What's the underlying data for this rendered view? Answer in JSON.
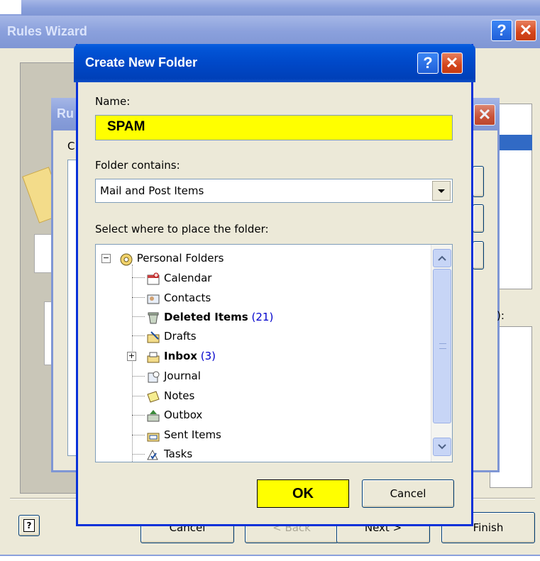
{
  "colors": {
    "title_active": "#0048c8",
    "title_inactive": "#8aa0dc",
    "highlight_yellow": "#ffff00",
    "count_blue": "#0000cc",
    "dialog_face": "#ece9d8"
  },
  "rules_wizard": {
    "title": "Rules Wizard",
    "buttons": {
      "cancel": "Cancel",
      "back": "< Back",
      "next": "Next >",
      "finish": "Finish"
    }
  },
  "middle_dialog": {
    "title_fragment": "Ru",
    "label_fragment": "C",
    "right_label_fragment": "):"
  },
  "create_new_folder": {
    "title": "Create New Folder",
    "name_label": "Name:",
    "name_value": "SPAM",
    "contains_label": "Folder contains:",
    "contains_value": "Mail and Post Items",
    "place_label": "Select where to place the folder:",
    "tree": {
      "root": {
        "label": "Personal Folders",
        "icon": "personal-folders-icon",
        "expander": "−"
      },
      "items": [
        {
          "label": "Calendar",
          "icon": "calendar-icon",
          "bold": false,
          "count": ""
        },
        {
          "label": "Contacts",
          "icon": "contacts-icon",
          "bold": false,
          "count": ""
        },
        {
          "label": "Deleted Items",
          "icon": "deleted-items-icon",
          "bold": true,
          "count": "(21)"
        },
        {
          "label": "Drafts",
          "icon": "drafts-icon",
          "bold": false,
          "count": ""
        },
        {
          "label": "Inbox",
          "icon": "inbox-icon",
          "bold": true,
          "count": "(3)",
          "expander": "+"
        },
        {
          "label": "Journal",
          "icon": "journal-icon",
          "bold": false,
          "count": ""
        },
        {
          "label": "Notes",
          "icon": "notes-icon",
          "bold": false,
          "count": ""
        },
        {
          "label": "Outbox",
          "icon": "outbox-icon",
          "bold": false,
          "count": ""
        },
        {
          "label": "Sent Items",
          "icon": "sent-items-icon",
          "bold": false,
          "count": ""
        },
        {
          "label": "Tasks",
          "icon": "tasks-icon",
          "bold": false,
          "count": ""
        }
      ]
    },
    "ok_label": "OK",
    "cancel_label": "Cancel"
  }
}
